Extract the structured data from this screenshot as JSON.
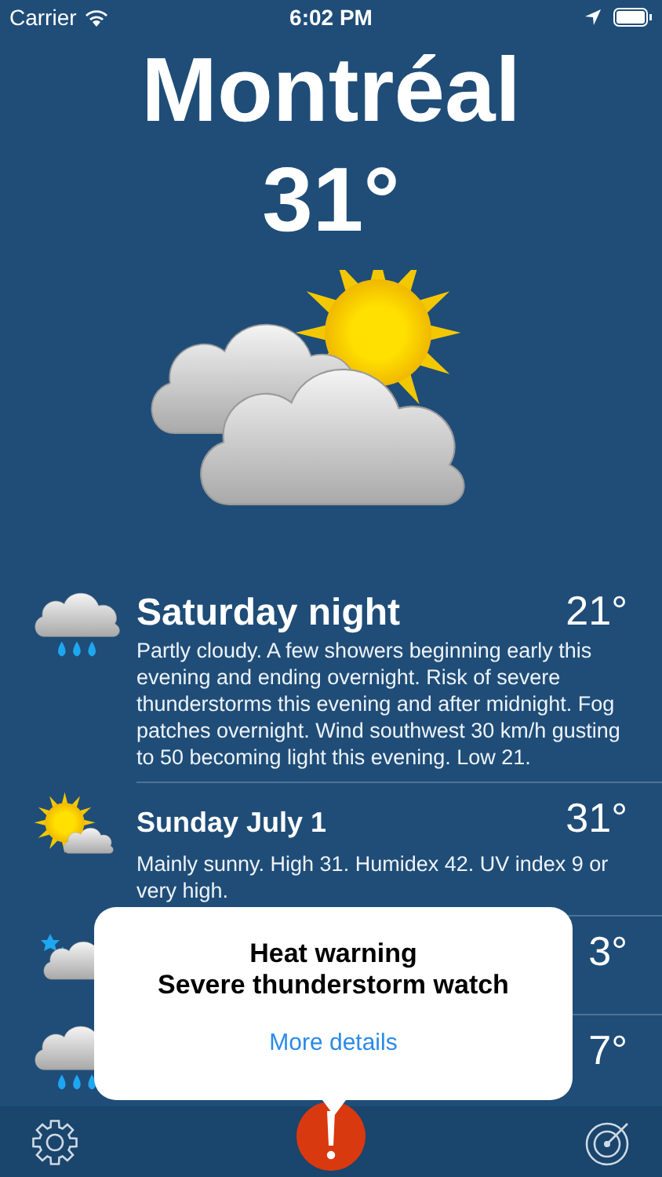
{
  "status_bar": {
    "carrier": "Carrier",
    "time": "6:02 PM"
  },
  "city": "Montréal",
  "temperature": "31°",
  "current": {
    "kind": "sun-cloud"
  },
  "forecast": [
    {
      "kind": "rain",
      "title": "Saturday night",
      "temp": "21°",
      "text": "Partly cloudy. A few showers beginning early this evening and ending overnight. Risk of severe thunderstorms this evening and after midnight. Fog patches overnight. Wind southwest 30 km/h gusting to 50 becoming light this evening. Low 21."
    },
    {
      "kind": "sun-cloud",
      "title": "Sunday July 1",
      "temp": "31°",
      "text": "Mainly sunny. High 31. Humidex 42. UV index 9 or very high."
    },
    {
      "kind": "night-cloud",
      "temp": "3°"
    },
    {
      "kind": "rain",
      "temp": "7°"
    }
  ],
  "alert": {
    "lines": [
      "Heat warning",
      "Severe thunderstorm watch"
    ],
    "link": "More details"
  }
}
